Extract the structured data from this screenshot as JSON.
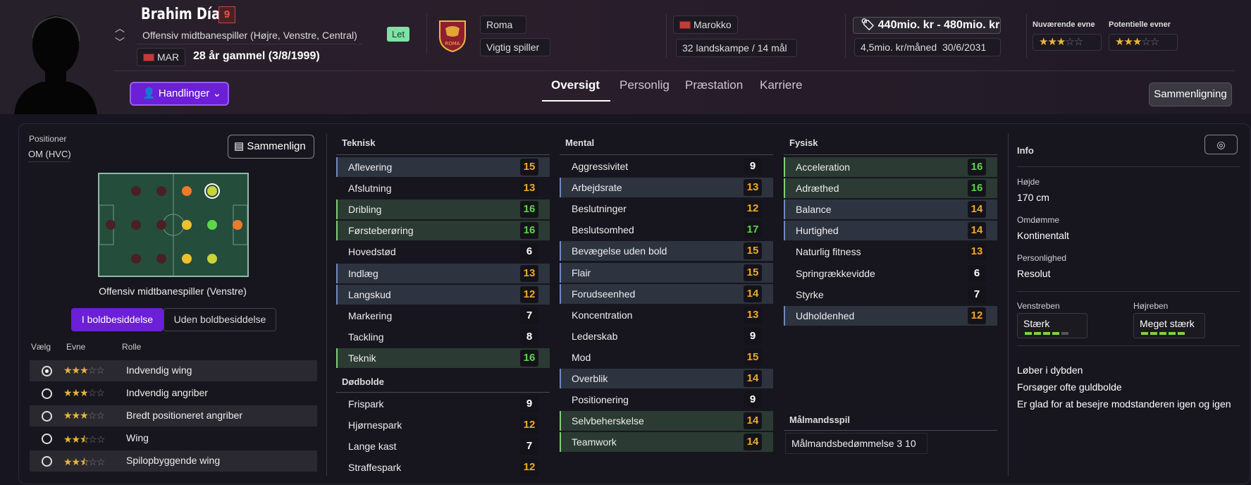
{
  "player": {
    "name": "Brahim Díaz",
    "number": "9",
    "position": "Offensiv midtbanespiller (Højre, Venstre, Central)",
    "nation_code": "MAR",
    "age": "28 år gammel (3/8/1999)",
    "tag": "Let"
  },
  "club": {
    "name": "Roma",
    "status": "Vigtig spiller",
    "crest_text": "ROMA"
  },
  "nation": {
    "name": "Marokko",
    "caps": "32 landskampe / 14 mål"
  },
  "value": {
    "range": "440mio. kr - 480mio. kr",
    "wage": "4,5mio. kr/måned",
    "contract": "30/6/2031"
  },
  "ability": {
    "current_label": "Nuværende evne",
    "potential_label": "Potentielle evner",
    "current_stars": 3,
    "potential_stars": 3
  },
  "actions": {
    "label": "Handlinger"
  },
  "tabs": [
    {
      "label": "Oversigt",
      "active": true
    },
    {
      "label": "Personlig"
    },
    {
      "label": "Præstation"
    },
    {
      "label": "Karriere"
    }
  ],
  "compare_label": "Sammenligning",
  "positions": {
    "title": "Positioner",
    "value": "OM (HVC)",
    "compare_btn": "Sammenlign",
    "role_caption": "Offensiv midtbanespiller (Venstre)",
    "toggle_on": "I boldbesiddelse",
    "toggle_off": "Uden boldbesiddelse",
    "col_select": "Vælg",
    "col_ability": "Evne",
    "col_role": "Rolle",
    "roles": [
      {
        "name": "Indvendig wing",
        "stars": 3,
        "selected": true
      },
      {
        "name": "Indvendig angriber",
        "stars": 3
      },
      {
        "name": "Bredt positioneret angriber",
        "stars": 3
      },
      {
        "name": "Wing",
        "stars": 2.5
      },
      {
        "name": "Spilopbyggende wing",
        "stars": 2.5
      }
    ]
  },
  "teknisk": {
    "title": "Teknisk",
    "rows": [
      {
        "name": "Aflevering",
        "value": "15",
        "hl": "b"
      },
      {
        "name": "Afslutning",
        "value": "13"
      },
      {
        "name": "Dribling",
        "value": "16",
        "hl": "g"
      },
      {
        "name": "Førsteberøring",
        "value": "16",
        "hl": "g"
      },
      {
        "name": "Hovedstød",
        "value": "6"
      },
      {
        "name": "Indlæg",
        "value": "13",
        "hl": "b"
      },
      {
        "name": "Langskud",
        "value": "12",
        "hl": "b"
      },
      {
        "name": "Markering",
        "value": "7"
      },
      {
        "name": "Tackling",
        "value": "8"
      },
      {
        "name": "Teknik",
        "value": "16",
        "hl": "g"
      }
    ]
  },
  "dodbolde": {
    "title": "Dødbolde",
    "rows": [
      {
        "name": "Frispark",
        "value": "9"
      },
      {
        "name": "Hjørnespark",
        "value": "12"
      },
      {
        "name": "Lange kast",
        "value": "7"
      },
      {
        "name": "Straffespark",
        "value": "12"
      }
    ]
  },
  "mental": {
    "title": "Mental",
    "rows": [
      {
        "name": "Aggressivitet",
        "value": "9"
      },
      {
        "name": "Arbejdsrate",
        "value": "13",
        "hl": "b"
      },
      {
        "name": "Beslutninger",
        "value": "12"
      },
      {
        "name": "Beslutsomhed",
        "value": "17"
      },
      {
        "name": "Bevægelse uden bold",
        "value": "15",
        "hl": "b"
      },
      {
        "name": "Flair",
        "value": "15",
        "hl": "b"
      },
      {
        "name": "Forudseenhed",
        "value": "14",
        "hl": "b"
      },
      {
        "name": "Koncentration",
        "value": "13"
      },
      {
        "name": "Lederskab",
        "value": "9"
      },
      {
        "name": "Mod",
        "value": "15"
      },
      {
        "name": "Overblik",
        "value": "14",
        "hl": "b"
      },
      {
        "name": "Positionering",
        "value": "9"
      },
      {
        "name": "Selvbeherskelse",
        "value": "14",
        "hl": "g"
      },
      {
        "name": "Teamwork",
        "value": "14",
        "hl": "g"
      }
    ]
  },
  "fysisk": {
    "title": "Fysisk",
    "rows": [
      {
        "name": "Acceleration",
        "value": "16",
        "hl": "g"
      },
      {
        "name": "Adræthed",
        "value": "16",
        "hl": "g"
      },
      {
        "name": "Balance",
        "value": "14",
        "hl": "b"
      },
      {
        "name": "Hurtighed",
        "value": "14",
        "hl": "b"
      },
      {
        "name": "Naturlig fitness",
        "value": "13"
      },
      {
        "name": "Springrækkevidde",
        "value": "6"
      },
      {
        "name": "Styrke",
        "value": "7"
      },
      {
        "name": "Udholdenhed",
        "value": "12",
        "hl": "b"
      }
    ]
  },
  "goalkeeping": {
    "title": "Målmandsspil",
    "text": "Målmandsbedømmelse 3 10"
  },
  "info": {
    "title": "Info",
    "height_label": "Højde",
    "height": "170 cm",
    "rep_label": "Omdømme",
    "rep": "Kontinentalt",
    "pers_label": "Personlighed",
    "pers": "Resolut",
    "left_label": "Venstreben",
    "left": "Stærk",
    "right_label": "Højreben",
    "right": "Meget stærk",
    "left_level": 0.8,
    "right_level": 1.0,
    "traits": [
      "Løber i dybden",
      "Forsøger ofte guldbolde",
      "Er glad for at besejre modstanderen igen og igen"
    ]
  },
  "colors": {
    "accent": "#6b1fd6",
    "orange": "#f0a82d",
    "green": "#5cd64c"
  }
}
